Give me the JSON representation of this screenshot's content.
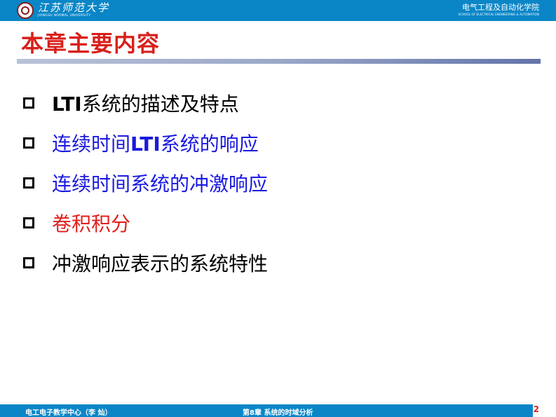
{
  "header": {
    "university_cn": "江苏师范大学",
    "university_en": "JIANGSU NORMAL UNIVERSITY",
    "college_cn": "电气工程及自动化学院",
    "college_en": "SCHOOL OF ELECTRICAL ENGINEERING & AUTOMATION"
  },
  "title": "本章主要内容",
  "items": [
    {
      "prefix": "LTI",
      "text": "系统的描述及特点"
    },
    {
      "lead": "连续时间",
      "prefix": "LTI",
      "text": "系统的响应"
    },
    {
      "text": "连续时间系统的冲激响应"
    },
    {
      "text": "卷积积分"
    },
    {
      "text": "冲激响应表示的系统特性"
    }
  ],
  "colors": {
    "header_bar": "#0a86c7",
    "title": "#d8201b",
    "blue_item": "#1a1ae0",
    "red_item": "#e0201b"
  },
  "footer": {
    "left": "电工电子教学中心（李 灿）",
    "center": "第8章 系统的时域分析",
    "page": "2"
  }
}
